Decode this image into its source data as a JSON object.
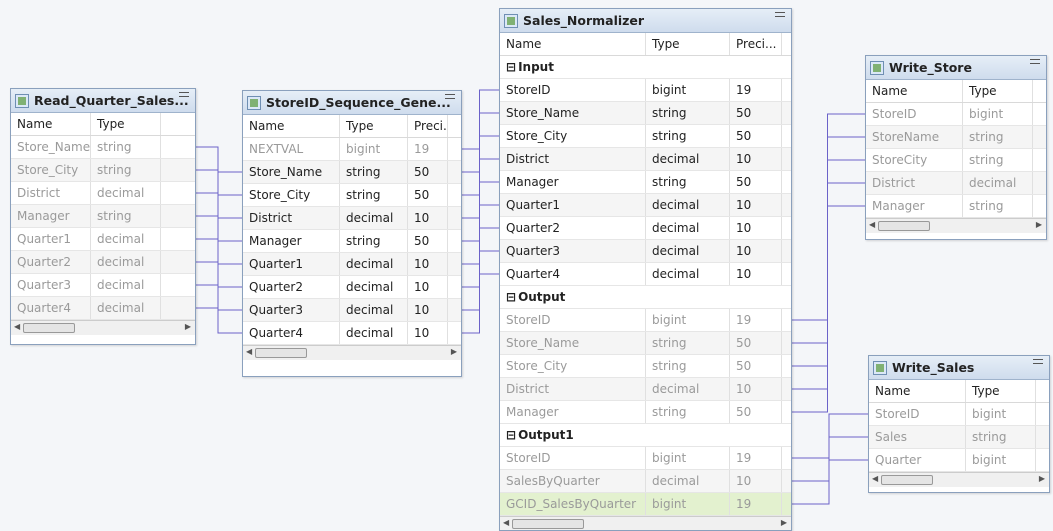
{
  "read_quarter": {
    "title": "Read_Quarter_Sales...",
    "headers": [
      "Name",
      "Type"
    ],
    "rows": [
      [
        "Store_Name",
        "string"
      ],
      [
        "Store_City",
        "string"
      ],
      [
        "District",
        "decimal"
      ],
      [
        "Manager",
        "string"
      ],
      [
        "Quarter1",
        "decimal"
      ],
      [
        "Quarter2",
        "decimal"
      ],
      [
        "Quarter3",
        "decimal"
      ],
      [
        "Quarter4",
        "decimal"
      ]
    ]
  },
  "sequence": {
    "title": "StoreID_Sequence_Gene...",
    "headers": [
      "Name",
      "Type",
      "Preci."
    ],
    "rows": [
      [
        "NEXTVAL",
        "bigint",
        "19"
      ],
      [
        "Store_Name",
        "string",
        "50"
      ],
      [
        "Store_City",
        "string",
        "50"
      ],
      [
        "District",
        "decimal",
        "10"
      ],
      [
        "Manager",
        "string",
        "50"
      ],
      [
        "Quarter1",
        "decimal",
        "10"
      ],
      [
        "Quarter2",
        "decimal",
        "10"
      ],
      [
        "Quarter3",
        "decimal",
        "10"
      ],
      [
        "Quarter4",
        "decimal",
        "10"
      ]
    ]
  },
  "normalizer": {
    "title": "Sales_Normalizer",
    "headers": [
      "Name",
      "Type",
      "Preci..."
    ],
    "groups": [
      {
        "label": "Input",
        "rows": [
          [
            "StoreID",
            "bigint",
            "19"
          ],
          [
            "Store_Name",
            "string",
            "50"
          ],
          [
            "Store_City",
            "string",
            "50"
          ],
          [
            "District",
            "decimal",
            "10"
          ],
          [
            "Manager",
            "string",
            "50"
          ],
          [
            "Quarter1",
            "decimal",
            "10"
          ],
          [
            "Quarter2",
            "decimal",
            "10"
          ],
          [
            "Quarter3",
            "decimal",
            "10"
          ],
          [
            "Quarter4",
            "decimal",
            "10"
          ]
        ]
      },
      {
        "label": "Output",
        "rows": [
          [
            "StoreID",
            "bigint",
            "19"
          ],
          [
            "Store_Name",
            "string",
            "50"
          ],
          [
            "Store_City",
            "string",
            "50"
          ],
          [
            "District",
            "decimal",
            "10"
          ],
          [
            "Manager",
            "string",
            "50"
          ]
        ]
      },
      {
        "label": "Output1",
        "rows": [
          [
            "StoreID",
            "bigint",
            "19"
          ],
          [
            "SalesByQuarter",
            "decimal",
            "10"
          ],
          [
            "GCID_SalesByQuarter",
            "bigint",
            "19"
          ]
        ]
      }
    ]
  },
  "write_store": {
    "title": "Write_Store",
    "headers": [
      "Name",
      "Type"
    ],
    "rows": [
      [
        "StoreID",
        "bigint"
      ],
      [
        "StoreName",
        "string"
      ],
      [
        "StoreCity",
        "string"
      ],
      [
        "District",
        "decimal"
      ],
      [
        "Manager",
        "string"
      ]
    ]
  },
  "write_sales": {
    "title": "Write_Sales",
    "headers": [
      "Name",
      "Type"
    ],
    "rows": [
      [
        "StoreID",
        "bigint"
      ],
      [
        "Sales",
        "string"
      ],
      [
        "Quarter",
        "bigint"
      ]
    ]
  },
  "colors": {
    "link": "#6b62c9",
    "header_bg": "#dbe6f2",
    "highlight": "#e3f1cf"
  }
}
